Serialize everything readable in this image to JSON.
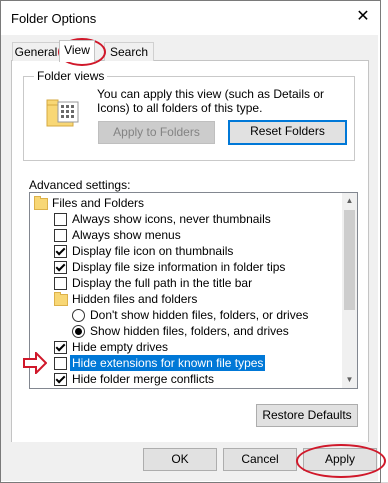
{
  "window": {
    "title": "Folder Options",
    "close_glyph": "✕"
  },
  "tabs": [
    {
      "label": "General"
    },
    {
      "label": "View",
      "active": true
    },
    {
      "label": "Search"
    }
  ],
  "folder_views": {
    "legend": "Folder views",
    "description": "You can apply this view (such as Details or Icons) to all folders of this type.",
    "apply_button": "Apply to Folders",
    "reset_button": "Reset Folders",
    "icon": "folder-views-icon"
  },
  "advanced": {
    "label": "Advanced settings:",
    "items": [
      {
        "type": "folder",
        "label": "Files and Folders",
        "indent": 0
      },
      {
        "type": "checkbox",
        "label": "Always show icons, never thumbnails",
        "checked": false
      },
      {
        "type": "checkbox",
        "label": "Always show menus",
        "checked": false
      },
      {
        "type": "checkbox",
        "label": "Display file icon on thumbnails",
        "checked": true
      },
      {
        "type": "checkbox",
        "label": "Display file size information in folder tips",
        "checked": true
      },
      {
        "type": "checkbox",
        "label": "Display the full path in the title bar",
        "checked": false
      },
      {
        "type": "folder",
        "label": "Hidden files and folders",
        "indent": 1
      },
      {
        "type": "radio",
        "label": "Don't show hidden files, folders, or drives",
        "checked": false
      },
      {
        "type": "radio",
        "label": "Show hidden files, folders, and drives",
        "checked": true
      },
      {
        "type": "checkbox",
        "label": "Hide empty drives",
        "checked": true
      },
      {
        "type": "checkbox",
        "label": "Hide extensions for known file types",
        "checked": false,
        "selected": true
      },
      {
        "type": "checkbox",
        "label": "Hide folder merge conflicts",
        "checked": true
      }
    ],
    "restore_button": "Restore Defaults"
  },
  "footer": {
    "ok": "OK",
    "cancel": "Cancel",
    "apply": "Apply"
  },
  "colors": {
    "accent": "#0078d7",
    "annotation": "#d0182a"
  }
}
